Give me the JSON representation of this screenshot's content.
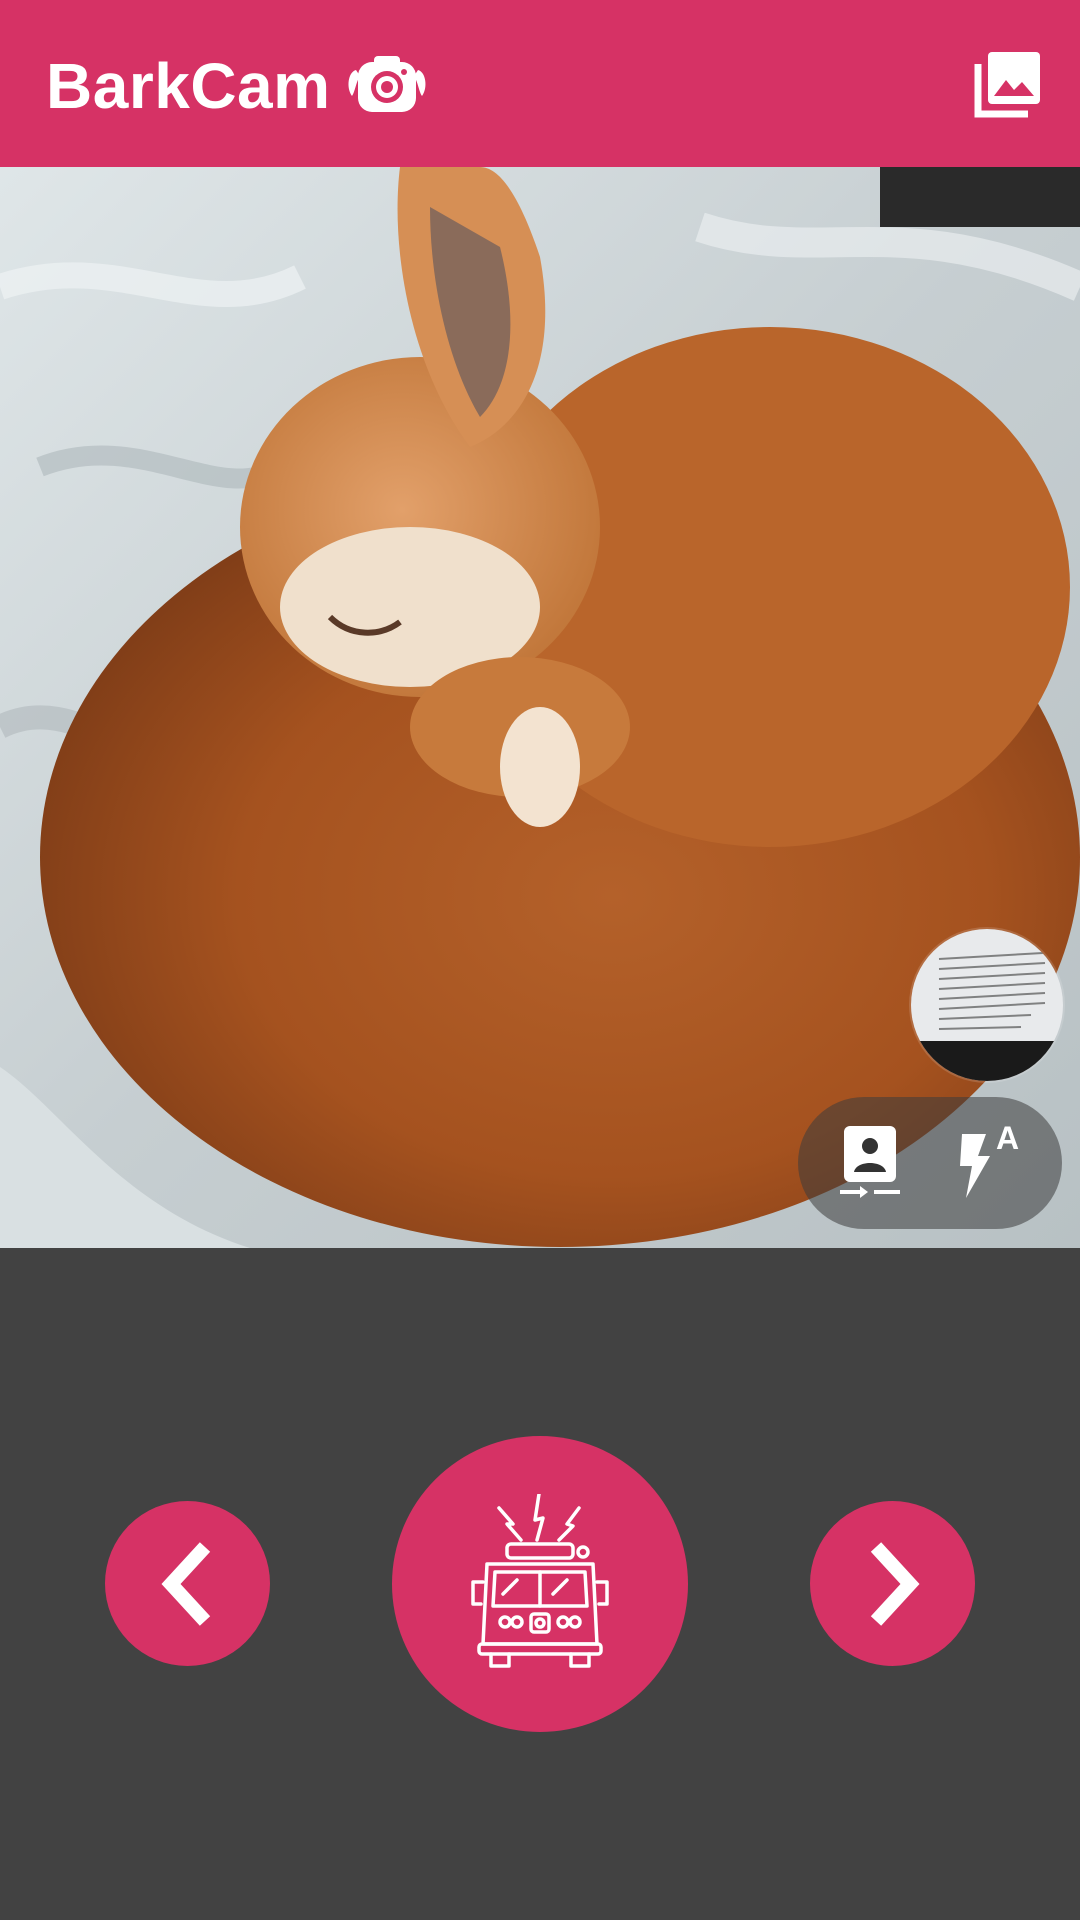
{
  "app_bar": {
    "title": "BarkCam",
    "logo_icon": "camera-dog-icon",
    "gallery_icon": "gallery-icon"
  },
  "viewfinder": {
    "subject": "camera-preview"
  },
  "camera_controls": {
    "thumbnail_icon": "last-photo-thumbnail",
    "switch_camera_icon": "switch-camera-icon",
    "flash_icon": "flash-auto-icon",
    "flash_mode_label": "A"
  },
  "bottom_controls": {
    "prev_icon": "chevron-left-icon",
    "bark_icon": "fire-truck-siren-icon",
    "next_icon": "chevron-right-icon"
  },
  "colors": {
    "accent": "#d63265",
    "background": "#424242",
    "icon": "#ffffff"
  }
}
